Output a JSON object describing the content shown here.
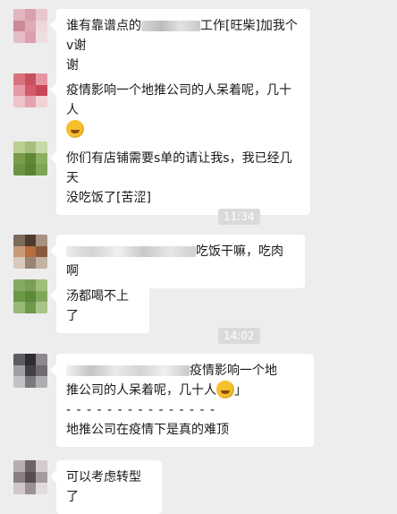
{
  "messages": [
    {
      "text1": "谁有靠谱点的",
      "text2": "工作[旺柴]加我个v谢",
      "line2": "谢"
    },
    {
      "text": "疫情影响一个地推公司的人呆着呢，几十人"
    },
    {
      "line1": "你们有店铺需要s单的请让我s，我已经几天",
      "line2": "没吃饭了[苦涩]"
    },
    {
      "text": "吃饭干嘛，吃肉啊"
    },
    {
      "text": "汤都喝不上了"
    },
    {
      "quote1": "疫情影响一个地",
      "quote2": "推公司的人呆着呢，几十人",
      "quote_close": "」",
      "divider": "- - - - - - - - - - - - - - -",
      "reply": "地推公司在疫情下是真的难顶"
    },
    {
      "text": "可以考虑转型了"
    }
  ],
  "timestamps": [
    "11:34",
    "14:02"
  ],
  "colors": {
    "background": "#ededed",
    "bubble": "#ffffff",
    "timestamp_bg": "#dadada"
  },
  "icons": {
    "emoji": "facepalm-laugh-emoji-icon"
  }
}
